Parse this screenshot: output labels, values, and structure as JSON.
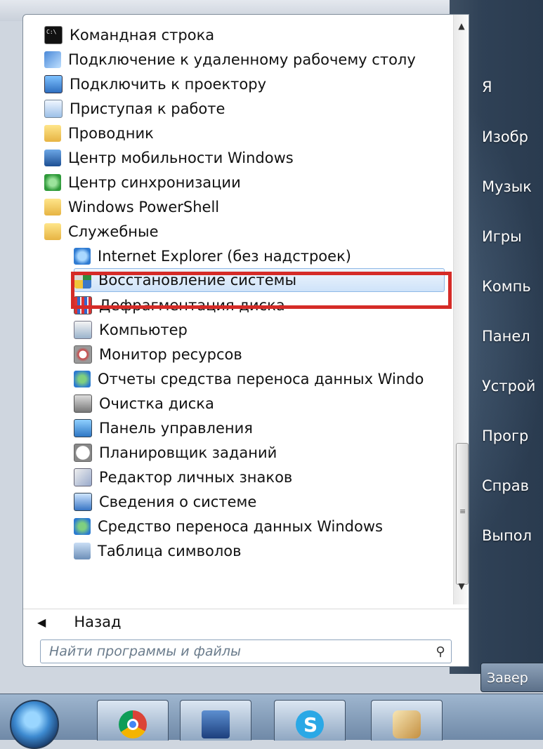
{
  "menu": {
    "items": [
      {
        "label": "Командная строка",
        "icon": "cmd-icon",
        "indent": 0
      },
      {
        "label": "Подключение к удаленному рабочему столу",
        "icon": "remote-desktop-icon",
        "indent": 0
      },
      {
        "label": "Подключить к проектору",
        "icon": "projector-icon",
        "indent": 0
      },
      {
        "label": "Приступая к работе",
        "icon": "getting-started-icon",
        "indent": 0
      },
      {
        "label": "Проводник",
        "icon": "explorer-folder-icon",
        "indent": 0
      },
      {
        "label": "Центр мобильности Windows",
        "icon": "mobility-center-icon",
        "indent": 0
      },
      {
        "label": "Центр синхронизации",
        "icon": "sync-center-icon",
        "indent": 0
      },
      {
        "label": "Windows PowerShell",
        "icon": "folder-icon",
        "indent": 0
      },
      {
        "label": "Служебные",
        "icon": "folder-icon",
        "indent": 0
      },
      {
        "label": "Internet Explorer (без надстроек)",
        "icon": "internet-explorer-icon",
        "indent": 1
      },
      {
        "label": "Восстановление системы",
        "icon": "system-restore-icon",
        "indent": 1,
        "selected": true
      },
      {
        "label": "Дефрагментация диска",
        "icon": "defrag-icon",
        "indent": 1
      },
      {
        "label": "Компьютер",
        "icon": "computer-icon",
        "indent": 1
      },
      {
        "label": "Монитор ресурсов",
        "icon": "resource-monitor-icon",
        "indent": 1
      },
      {
        "label": "Отчеты средства переноса данных Windo",
        "icon": "transfer-reports-icon",
        "indent": 1
      },
      {
        "label": "Очистка диска",
        "icon": "disk-cleanup-icon",
        "indent": 1
      },
      {
        "label": "Панель управления",
        "icon": "control-panel-icon",
        "indent": 1
      },
      {
        "label": "Планировщик заданий",
        "icon": "task-scheduler-icon",
        "indent": 1
      },
      {
        "label": "Редактор личных знаков",
        "icon": "char-editor-icon",
        "indent": 1
      },
      {
        "label": "Сведения о системе",
        "icon": "system-info-icon",
        "indent": 1
      },
      {
        "label": "Средство переноса данных Windows",
        "icon": "easy-transfer-icon",
        "indent": 1
      },
      {
        "label": "Таблица символов",
        "icon": "charmap-icon",
        "indent": 1
      }
    ],
    "back_label": "Назад",
    "search_placeholder": "Найти программы и файлы"
  },
  "right_pane": {
    "items": [
      "Я",
      "Изобр",
      "Музык",
      "Игры",
      "Компь",
      "Панел",
      "Устрой",
      "Прогр",
      "Справ",
      "Выпол"
    ],
    "shutdown_label": "Завер"
  },
  "taskbar": {
    "buttons": [
      "start-orb",
      "chrome",
      "save",
      "skype",
      "paint"
    ]
  }
}
